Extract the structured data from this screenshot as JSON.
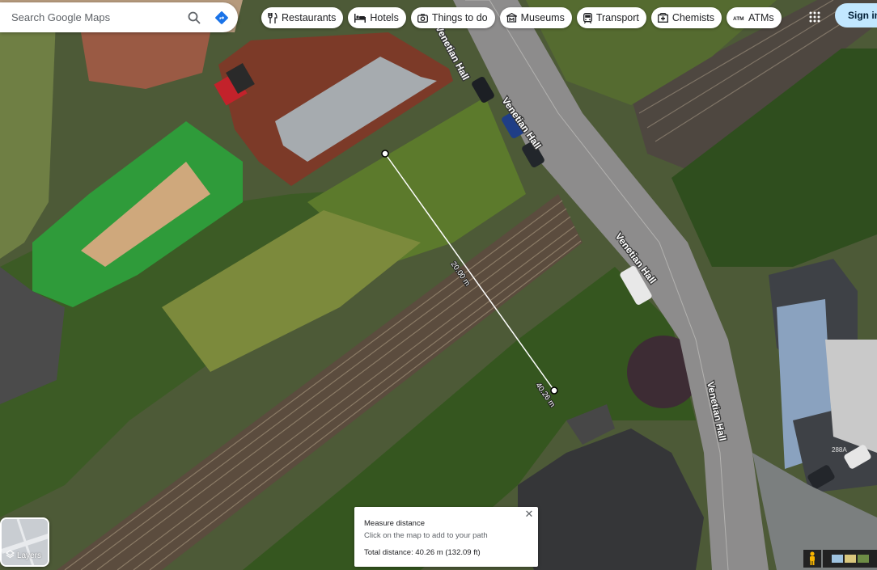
{
  "search": {
    "placeholder": "Search Google Maps"
  },
  "chips": [
    {
      "label": "Restaurants",
      "icon": "restaurant-icon"
    },
    {
      "label": "Hotels",
      "icon": "hotel-icon"
    },
    {
      "label": "Things to do",
      "icon": "camera-icon"
    },
    {
      "label": "Museums",
      "icon": "museum-icon"
    },
    {
      "label": "Transport",
      "icon": "transit-icon"
    },
    {
      "label": "Chemists",
      "icon": "pharmacy-icon"
    },
    {
      "label": "ATMs",
      "icon": "atm-icon"
    }
  ],
  "header": {
    "signin_label": "Sign in"
  },
  "map": {
    "street_labels": [
      "Venetian Hall",
      "Venetian Hall",
      "Venetian Hall",
      "Venetian Hall"
    ],
    "segment_label": "20.00 m",
    "endpoint_label": "40.26 m",
    "house_number": "288A"
  },
  "layers": {
    "label": "Layers"
  },
  "measure": {
    "title": "Measure distance",
    "hint": "Click on the map to add to your path",
    "total": "Total distance: 40.26 m (132.09 ft)"
  },
  "colors": {
    "accent": "#1a73e8",
    "signin_bg": "#c2e7ff"
  }
}
